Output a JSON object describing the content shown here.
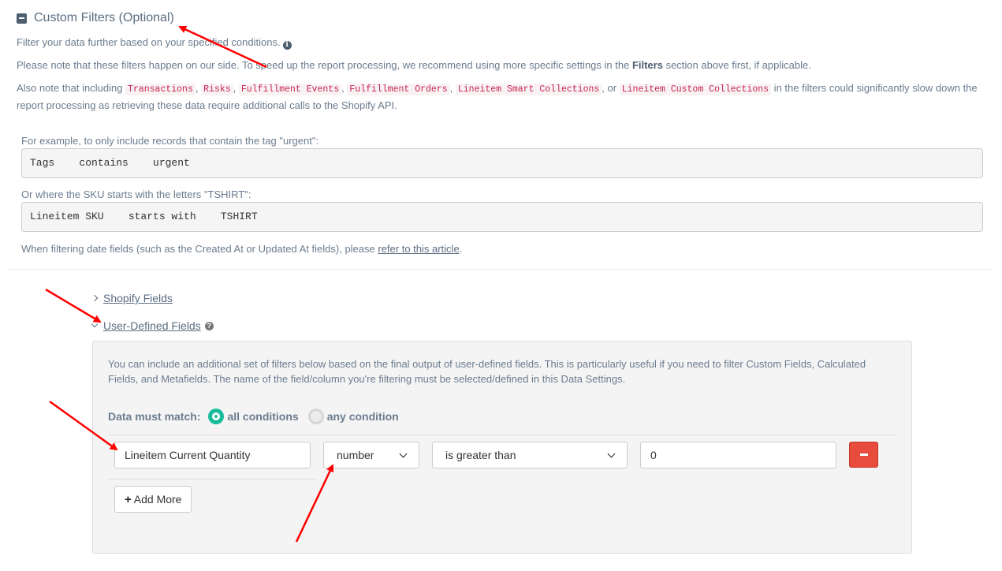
{
  "section": {
    "title": "Custom Filters (Optional)",
    "intro": "Filter your data further based on your specified conditions.",
    "note_prefix": "Please note that these filters happen on our side. To speed up the report processing, we recommend using more specific settings in the ",
    "note_bold": "Filters",
    "note_suffix": " section above first, if applicable.",
    "also_prefix": "Also note that including ",
    "codes": [
      "Transactions",
      "Risks",
      "Fulfillment Events",
      "Fulfillment Orders",
      "Lineitem Smart Collections",
      "Lineitem Custom Collections"
    ],
    "comma": ",",
    "or_text": ", or",
    "also_suffix": " in the filters could significantly slow down the report processing as retrieving these data require additional calls to the Shopify API."
  },
  "examples": {
    "tag_label": "For example, to only include records that contain the tag \"urgent\":",
    "tag_code": "Tags    contains    urgent",
    "sku_label": "Or where the SKU starts with the letters \"TSHIRT\":",
    "sku_code": "Lineitem SKU    starts with    TSHIRT",
    "date_prefix": "When filtering date fields (such as the Created At or Updated At fields), please ",
    "date_link": "refer to this article",
    "date_suffix": "."
  },
  "tree": {
    "shopify_fields": "Shopify Fields",
    "user_defined_fields": "User-Defined Fields"
  },
  "panel": {
    "description": "You can include an additional set of filters below based on the final output of user-defined fields. This is particularly useful if you need to filter Custom Fields, Calculated Fields, and Metafields. The name of the field/column you're filtering must be selected/defined in this Data Settings.",
    "match_label": "Data must match:",
    "match_all": "all conditions",
    "match_any": "any condition",
    "match_selected": "all conditions",
    "filter": {
      "field": "Lineitem Current Quantity",
      "type": "number",
      "operator": "is greater than",
      "value": "0"
    },
    "add_more": "Add More"
  },
  "colors": {
    "accent_green": "#18bc9c",
    "danger_red": "#e74c3c",
    "annotation_red": "#ff0000"
  }
}
